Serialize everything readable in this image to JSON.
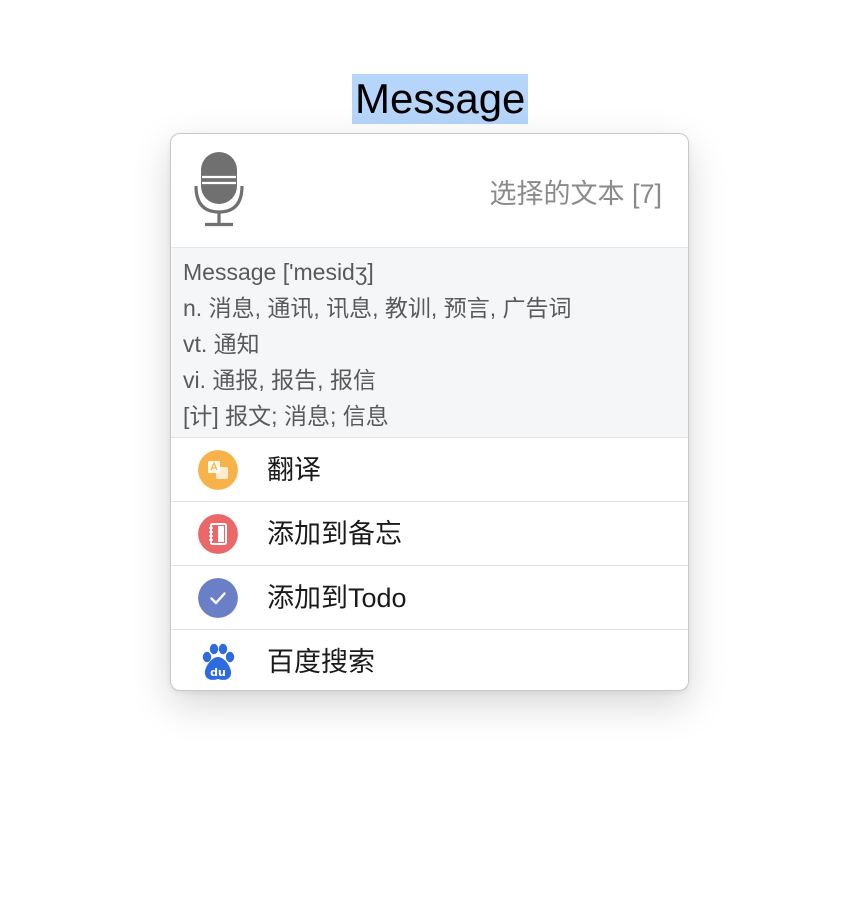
{
  "selected_word": "Message",
  "popup": {
    "header": {
      "mic_icon": "microphone-icon",
      "selection_info": "选择的文本 [7]"
    },
    "definitions": [
      "Message ['mesidʒ]",
      "n. 消息, 通讯, 讯息, 教训, 预言, 广告词",
      "vt. 通知",
      "vi. 通报, 报告, 报信",
      "[计] 报文; 消息; 信息"
    ],
    "actions": [
      {
        "label": "翻译",
        "icon": "translate-icon",
        "color": "#f7b24a"
      },
      {
        "label": "添加到备忘",
        "icon": "notebook-icon",
        "color": "#ec6767"
      },
      {
        "label": "添加到Todo",
        "icon": "checkmark-icon",
        "color": "#6a7fc5"
      },
      {
        "label": "百度搜索",
        "icon": "baidu-icon",
        "color": "#2f6be0"
      }
    ]
  },
  "colors": {
    "selection_highlight": "#b5d5fb",
    "definitions_bg": "#f5f6f8"
  }
}
